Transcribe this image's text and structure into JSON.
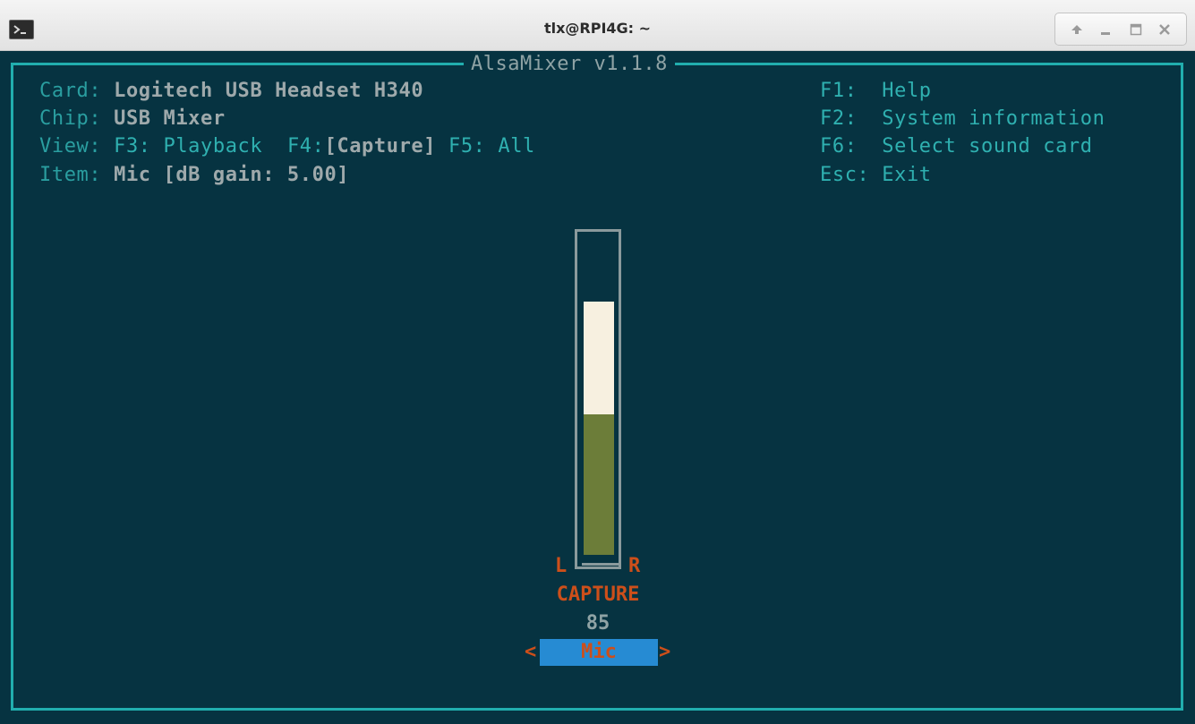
{
  "window": {
    "title": "tlx@RPI4G: ~",
    "icon": "terminal-icon",
    "controls": [
      "up-arrow-icon",
      "minimize-icon",
      "maximize-icon",
      "close-icon"
    ]
  },
  "mixer": {
    "title": "AlsaMixer v1.1.8",
    "info": {
      "card_label": "Card:",
      "card_value": "Logitech USB Headset H340",
      "chip_label": "Chip:",
      "chip_value": "USB Mixer",
      "view_label": "View:",
      "view_f3": "F3: Playback",
      "view_f4_key": "F4:",
      "view_f4_value": "[Capture]",
      "view_f5": "F5: All",
      "item_label": "Item:",
      "item_value": "Mic [dB gain: 5.00]"
    },
    "help": [
      {
        "key": "F1:",
        "text": "Help"
      },
      {
        "key": "F2:",
        "text": "System information"
      },
      {
        "key": "F6:",
        "text": "Select sound card"
      },
      {
        "key": "Esc:",
        "text": "Exit"
      }
    ],
    "control": {
      "left_label": "L",
      "right_label": "R",
      "capture_label": "CAPTURE",
      "volume": "85",
      "volume_fraction": 0.85,
      "name": "Mic",
      "prev_arrow": "<",
      "next_arrow": ">"
    }
  },
  "colors": {
    "terminal_bg": "#063341",
    "frame": "#21aeae",
    "label": "#2a9ea0",
    "value": "#9ea9ab",
    "accent_orange": "#cd4f1a",
    "selection_blue": "#268bd3",
    "fill_light": "#f7f0e0",
    "fill_green": "#6c7d39"
  }
}
